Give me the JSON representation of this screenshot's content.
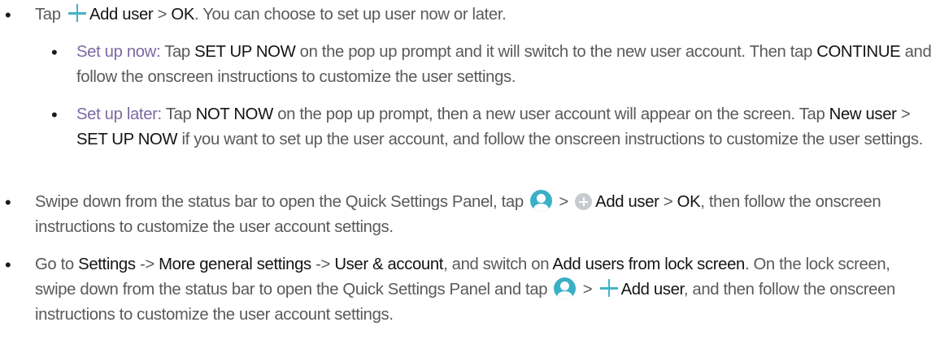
{
  "bullet_symbol": "•",
  "item1": {
    "tap": "Tap",
    "add_user": "Add user",
    "gt": ">",
    "ok": "OK",
    "rest": ". You can choose to set up user now or later."
  },
  "sub1": {
    "label": "Set up now:",
    "t1": "Tap",
    "setup_now": "SET UP NOW",
    "t2": "on the pop up prompt and it will switch to the new user account. Then tap",
    "continue": "CONTINUE",
    "t3": "and follow the onscreen instructions to customize the user settings."
  },
  "sub2": {
    "label": "Set up later:",
    "t1": "Tap",
    "not_now": "NOT NOW",
    "t2": "on the pop up prompt, then a new user account will appear on the screen. Tap",
    "new_user": "New user",
    "gt": ">",
    "setup_now": "SET UP NOW",
    "t3": "if you want to set up the user account, and follow the onscreen instructions to customize the user settings."
  },
  "item2": {
    "t1": "Swipe down from the status bar to open the Quick Settings Panel, tap",
    "gt1": ">",
    "add_user": "Add user",
    "gt2": ">",
    "ok": "OK",
    "t2": ", then follow the onscreen instructions to customize the user account settings."
  },
  "item3": {
    "t1": "Go to",
    "settings": "Settings",
    "arrow1": "->",
    "more_general": "More general settings",
    "arrow2": "->",
    "user_account": "User & account",
    "t2": ", and switch on",
    "add_users_lock": "Add users from lock screen",
    "t3": ". On the lock screen, swipe down from the status bar to open the Quick Settings Panel and tap",
    "gt1": ">",
    "add_user": "Add user",
    "t4": ", and then follow the onscreen instructions to customize the user account settings."
  },
  "icons": {
    "plus": "plus-icon",
    "user": "user-icon",
    "circle_plus": "circle-plus-icon",
    "accent_color": "#3ab0c6"
  }
}
